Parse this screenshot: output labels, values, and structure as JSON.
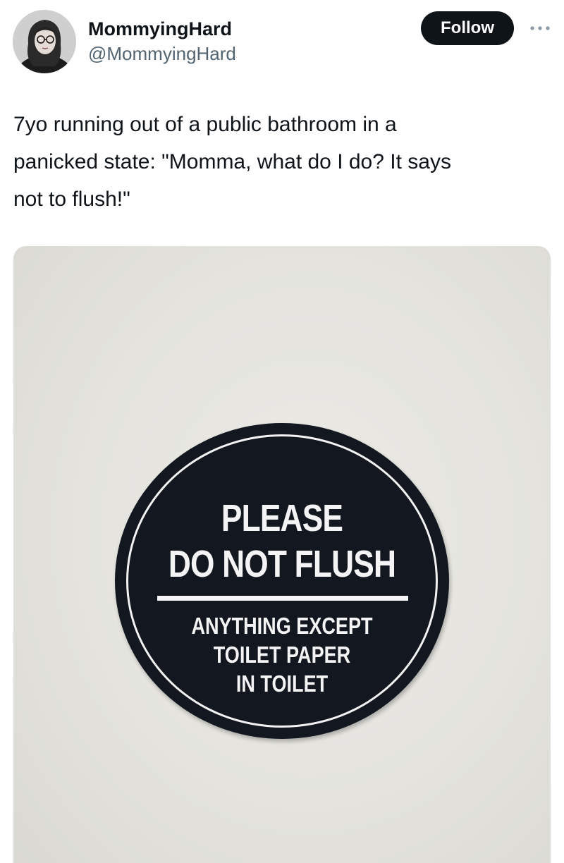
{
  "author": {
    "display_name": "MommyingHard",
    "handle": "@MommyingHard",
    "avatar_icon": "user-avatar-photo"
  },
  "actions": {
    "follow_label": "Follow",
    "more_icon": "more-horizontal-icon"
  },
  "tweet": {
    "text": "7yo running out of a public bathroom in a\npanicked state: \"Momma, what do I do? It says\nnot to flush!\""
  },
  "media": {
    "sign": {
      "line1": "PLEASE",
      "line2": "DO NOT FLUSH",
      "sub1": "ANYTHING EXCEPT",
      "sub2": "TOILET PAPER",
      "sub3": "IN TOILET"
    },
    "colors": {
      "sign_background": "#121720",
      "sign_text": "#f4f4f4",
      "wall": "#e3e2dd"
    }
  },
  "colors": {
    "primary_text": "#0f1419",
    "secondary_text": "#536471",
    "follow_button_bg": "#0f1419",
    "follow_button_text": "#ffffff"
  }
}
